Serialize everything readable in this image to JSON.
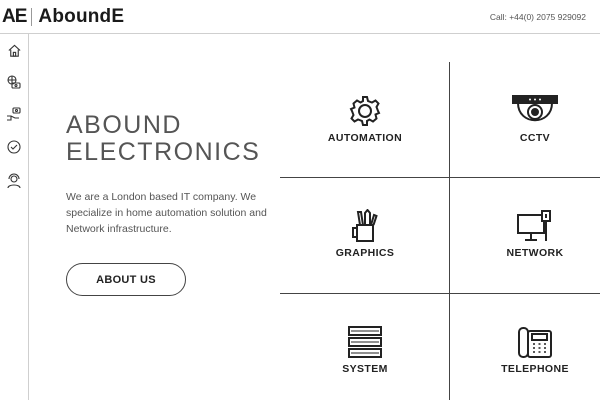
{
  "header": {
    "logo_mark": "AE",
    "logo_word": "AboundE",
    "phone": "Call: +44(0) 2075 929092"
  },
  "sidebar": {
    "items": [
      {
        "icon": "home-icon"
      },
      {
        "icon": "globe-money-icon"
      },
      {
        "icon": "hand-coin-icon"
      },
      {
        "icon": "handshake-icon"
      },
      {
        "icon": "support-agent-icon"
      }
    ]
  },
  "hero": {
    "title_line1": "ABOUND",
    "title_line2": "ELECTRONICS",
    "description": "We are a London based IT company. We specialize in home automation solution and Network infrastructure.",
    "button_label": "ABOUT US"
  },
  "services": [
    {
      "label": "AUTOMATION",
      "icon": "gear-icon"
    },
    {
      "label": "CCTV",
      "icon": "camera-icon"
    },
    {
      "label": "GRAPHICS",
      "icon": "pencil-cup-icon"
    },
    {
      "label": "NETWORK",
      "icon": "monitor-network-icon"
    },
    {
      "label": "SYSTEM",
      "icon": "server-icon"
    },
    {
      "label": "TELEPHONE",
      "icon": "phone-icon"
    }
  ],
  "colors": {
    "line": "#444444",
    "text": "#222222",
    "muted": "#555555"
  }
}
